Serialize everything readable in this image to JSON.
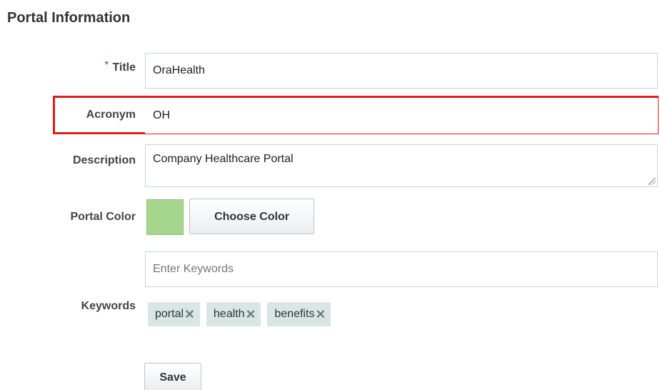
{
  "section": {
    "title": "Portal Information"
  },
  "fields": {
    "title": {
      "required_marker": "*",
      "label": "Title",
      "value": "OraHealth"
    },
    "acronym": {
      "label": "Acronym",
      "value": "OH"
    },
    "description": {
      "label": "Description",
      "value": "Company Healthcare Portal"
    },
    "portal_color": {
      "label": "Portal Color",
      "swatch_color": "#a6d68d",
      "button_label": "Choose Color"
    },
    "keywords": {
      "label": "Keywords",
      "placeholder": "Enter Keywords",
      "tags": [
        "portal",
        "health",
        "benefits"
      ]
    }
  },
  "actions": {
    "save_label": "Save"
  },
  "colors": {
    "highlight": "#e01b1b",
    "required_marker": "#2b6cb0",
    "tag_bg": "#d9e6e6"
  }
}
